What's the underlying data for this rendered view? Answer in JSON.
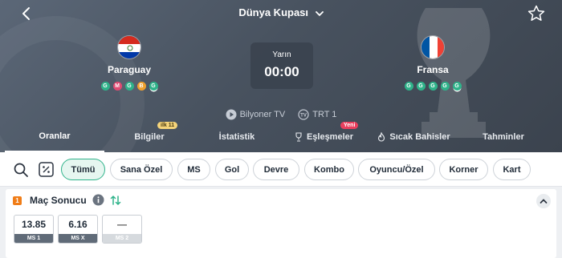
{
  "header": {
    "title": "Dünya Kupası",
    "home": {
      "name": "Paraguay",
      "form": [
        "G",
        "M",
        "G",
        "B",
        "G"
      ]
    },
    "away": {
      "name": "Fransa",
      "form": [
        "G",
        "G",
        "G",
        "G",
        "G"
      ]
    },
    "kickoff": {
      "day": "Yarın",
      "time": "00:00"
    },
    "broadcasts": [
      "Bilyoner TV",
      "TRT 1"
    ]
  },
  "tabs": [
    {
      "label": "Oranlar",
      "active": true
    },
    {
      "label": "Bilgiler",
      "badge": "ilk 11"
    },
    {
      "label": "İstatistik"
    },
    {
      "label": "Eşleşmeler",
      "badge": "Yeni"
    },
    {
      "label": "Sıcak Bahisler"
    },
    {
      "label": "Tahminler"
    }
  ],
  "filters": [
    "Tümü",
    "Sana Özel",
    "MS",
    "Gol",
    "Devre",
    "Kombo",
    "Oyuncu/Özel",
    "Korner",
    "Kart"
  ],
  "market": {
    "number": "1",
    "title": "Maç Sonucu",
    "odds": [
      {
        "value": "13.85",
        "label": "MS 1"
      },
      {
        "value": "6.16",
        "label": "MS X"
      },
      {
        "value": "—",
        "label": "MS 2",
        "disabled": true
      }
    ]
  },
  "colors": {
    "accent": "#2fb38a",
    "lose": "#e24a72",
    "draw": "#f0a12e",
    "market_number": "#f07d18"
  }
}
